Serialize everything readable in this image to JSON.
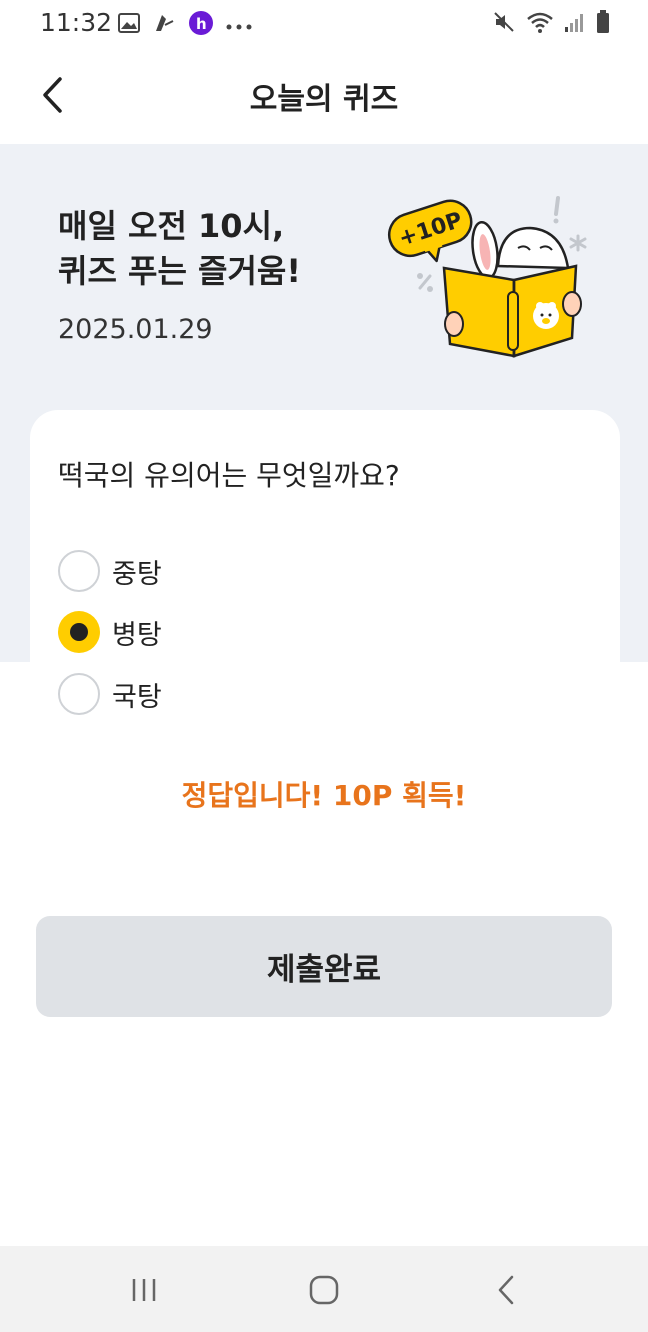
{
  "status_bar": {
    "time": "11:32",
    "left_icons": [
      "gallery-icon",
      "sign-icon",
      "h-app-icon",
      "more-dots-icon"
    ],
    "right_icons": [
      "mute-icon",
      "wifi-icon",
      "signal-icon",
      "battery-icon"
    ]
  },
  "header": {
    "title": "오늘의 퀴즈",
    "back_icon": "back-arrow-icon"
  },
  "banner": {
    "title_line1": "매일 오전 10시,",
    "title_line2": "퀴즈 푸는 즐거움!",
    "date": "2025.01.29",
    "badge_text": "+10P"
  },
  "quiz": {
    "question": "떡국의 유의어는 무엇일까요?",
    "options": [
      {
        "label": "중탕",
        "selected": false
      },
      {
        "label": "병탕",
        "selected": true
      },
      {
        "label": "국탕",
        "selected": false
      }
    ],
    "result": "정답입니다! 10P 획득!",
    "submit_label": "제출완료"
  },
  "colors": {
    "accent": "#ffcd00",
    "result": "#e8741c",
    "banner_bg": "#eef1f6",
    "button_bg": "#dfe2e6"
  },
  "nav_bar": {
    "icons": [
      "recent-apps-icon",
      "home-icon",
      "back-icon"
    ]
  }
}
